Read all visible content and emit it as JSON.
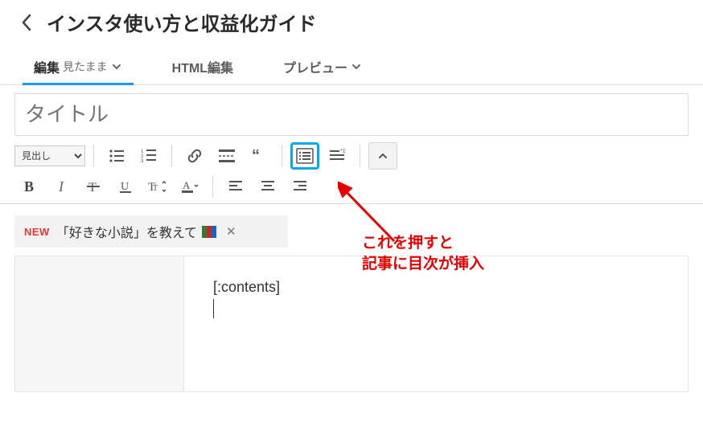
{
  "header": {
    "title": "インスタ使い方と収益化ガイド"
  },
  "tabs": {
    "edit_label": "編集",
    "edit_mode": "見たまま",
    "html_label": "HTML編集",
    "preview_label": "プレビュー"
  },
  "title_input": {
    "placeholder": "タイトル"
  },
  "toolbar": {
    "heading_placeholder": "見出し"
  },
  "annotation": {
    "line1": "これを押すと",
    "line2": "記事に目次が挿入"
  },
  "prompt": {
    "new_badge": "NEW",
    "text": "「好きな小説」を教えて"
  },
  "editor": {
    "contents_token": "[:contents]"
  }
}
